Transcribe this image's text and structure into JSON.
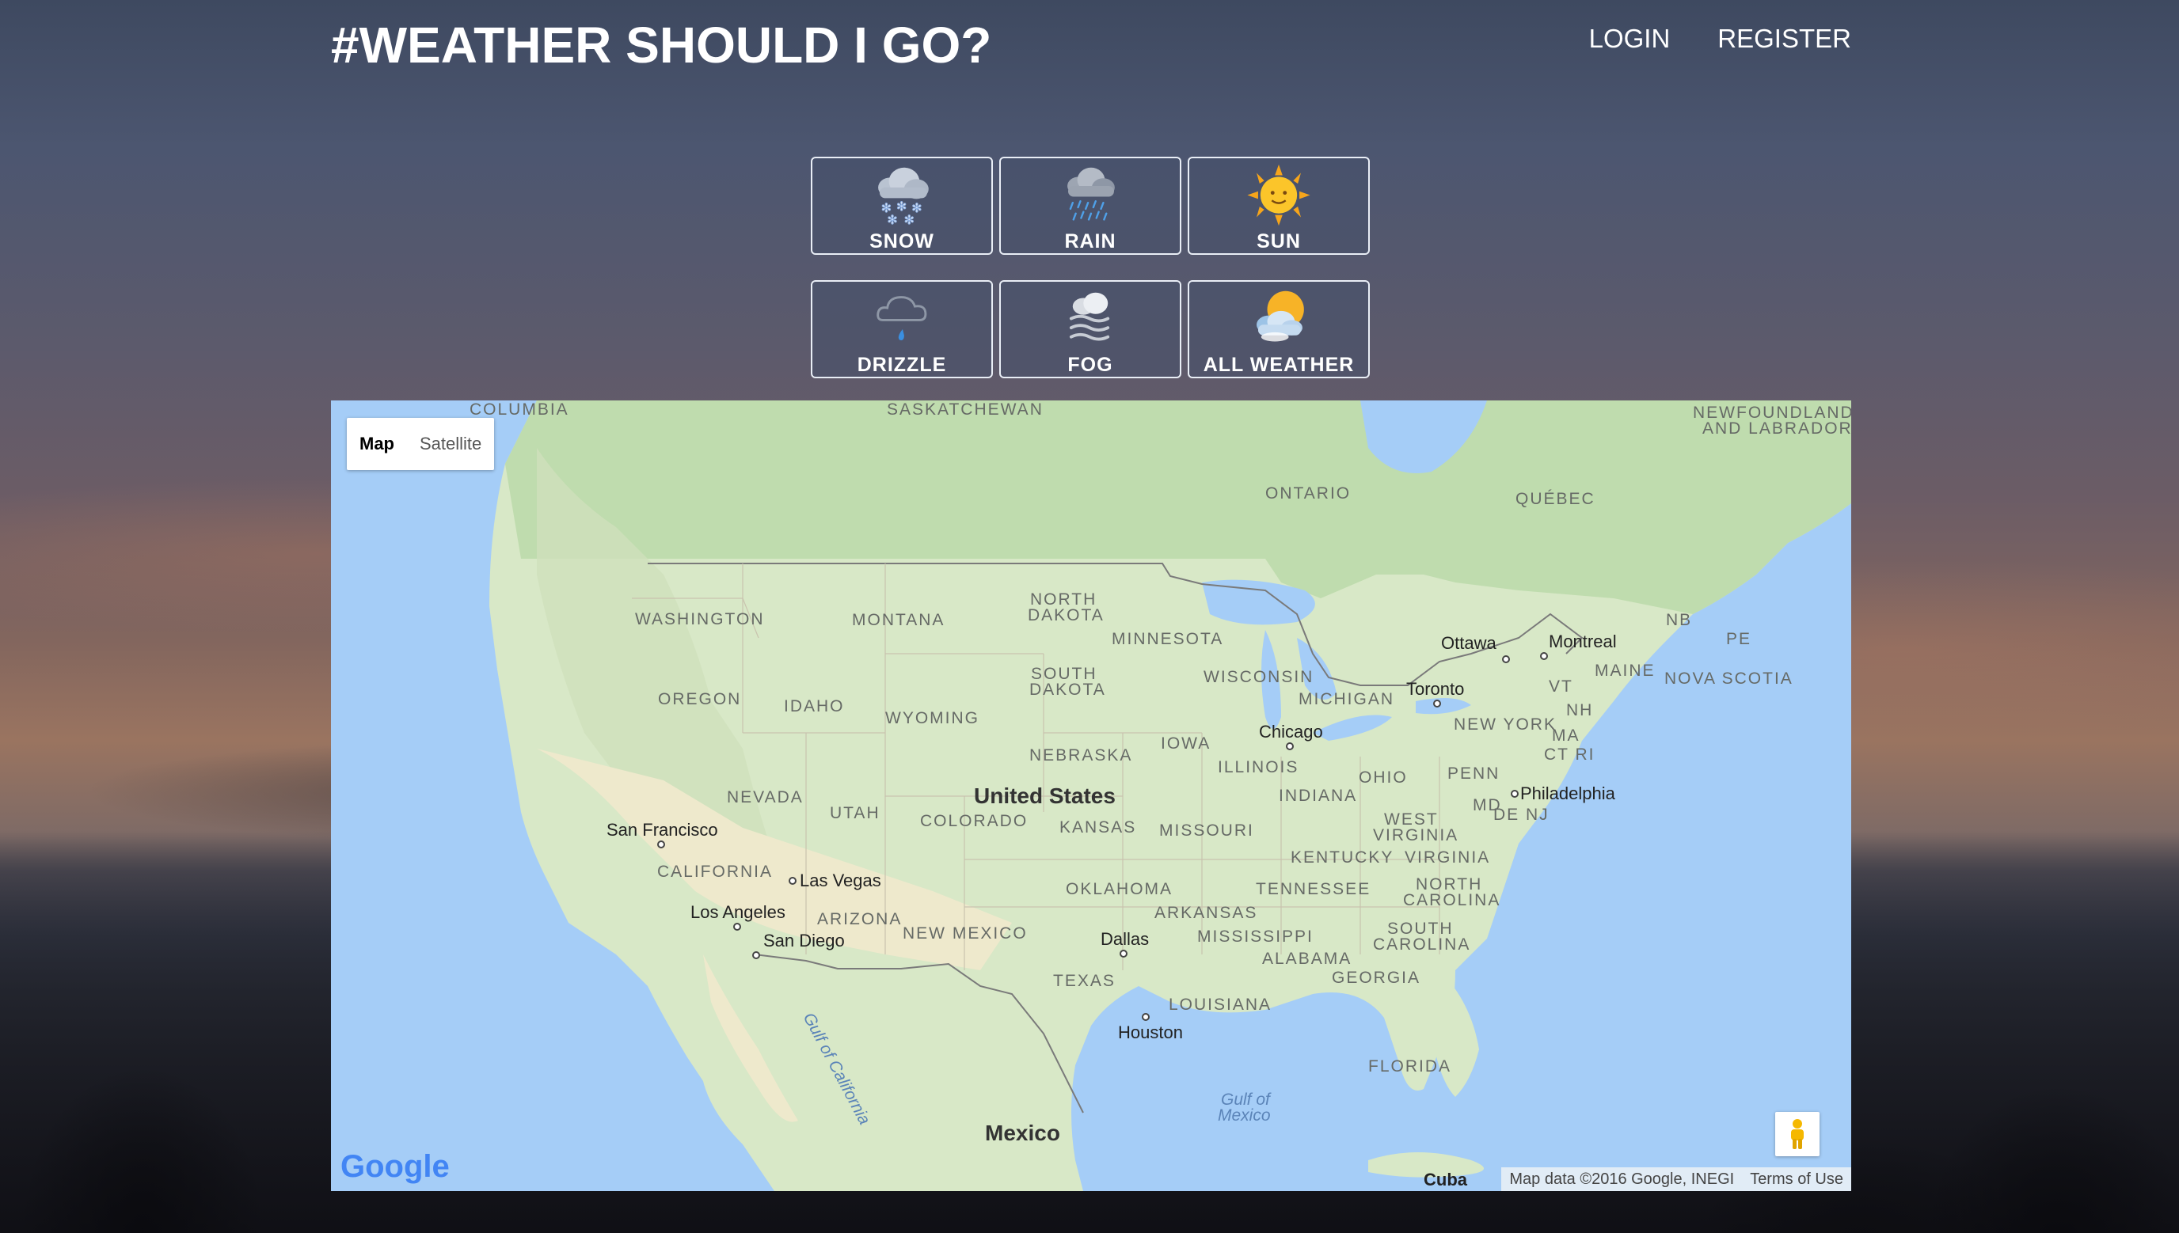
{
  "header": {
    "title": "#WEATHER SHOULD I GO?",
    "nav": {
      "login": "LOGIN",
      "register": "REGISTER"
    }
  },
  "weather_buttons": [
    {
      "label": "SNOW",
      "icon": "snow-cloud-icon"
    },
    {
      "label": "RAIN",
      "icon": "rain-cloud-icon"
    },
    {
      "label": "SUN",
      "icon": "sun-icon"
    },
    {
      "label": "DRIZZLE",
      "icon": "drizzle-cloud-icon"
    },
    {
      "label": "FOG",
      "icon": "fog-icon"
    },
    {
      "label": "ALL WEATHER",
      "icon": "sun-behind-cloud-icon"
    }
  ],
  "map": {
    "type_control": {
      "map": "Map",
      "satellite": "Satellite",
      "active": "Map"
    },
    "regions": {
      "columbia": "COLUMBIA",
      "saskatchewan": "SASKATCHEWAN",
      "newfoundland1": "NEWFOUNDLAND",
      "newfoundland2": "AND LABRADOR",
      "ontario": "ONTARIO",
      "quebec": "QUÉBEC",
      "washington": "WASHINGTON",
      "montana": "MONTANA",
      "north_dakota1": "NORTH",
      "north_dakota2": "DAKOTA",
      "minnesota": "MINNESOTA",
      "oregon": "OREGON",
      "idaho": "IDAHO",
      "south_dakota1": "SOUTH",
      "south_dakota2": "DAKOTA",
      "wyoming": "WYOMING",
      "wisconsin": "WISCONSIN",
      "michigan": "MICHIGAN",
      "nebraska": "NEBRASKA",
      "iowa": "IOWA",
      "illinois": "ILLINOIS",
      "ohio": "OHIO",
      "nevada": "NEVADA",
      "utah": "UTAH",
      "colorado": "COLORADO",
      "kansas": "KANSAS",
      "missouri": "MISSOURI",
      "indiana": "INDIANA",
      "california": "CALIFORNIA",
      "oklahoma": "OKLAHOMA",
      "arizona": "ARIZONA",
      "new_mexico": "NEW MEXICO",
      "arkansas": "ARKANSAS",
      "tennessee": "TENNESSEE",
      "kentucky": "KENTUCKY",
      "west_virginia1": "WEST",
      "west_virginia2": "VIRGINIA",
      "virginia": "VIRGINIA",
      "north_carolina1": "NORTH",
      "north_carolina2": "CAROLINA",
      "south_carolina1": "SOUTH",
      "south_carolina2": "CAROLINA",
      "mississippi": "MISSISSIPPI",
      "alabama": "ALABAMA",
      "georgia": "GEORGIA",
      "texas": "TEXAS",
      "louisiana": "LOUISIANA",
      "florida": "FLORIDA",
      "penn": "PENN",
      "new_york": "NEW YORK",
      "nb": "NB",
      "pe": "PE",
      "maine": "MAINE",
      "nova_scotia": "NOVA SCOTIA",
      "vt": "VT",
      "nh": "NH",
      "ma": "MA",
      "ct_ri": "CT RI",
      "md": "MD",
      "de_nj": "DE NJ"
    },
    "cities": {
      "ottawa": "Ottawa",
      "montreal": "Montreal",
      "toronto": "Toronto",
      "chicago": "Chicago",
      "philadelphia": "Philadelphia",
      "san_francisco": "San Francisco",
      "las_vegas": "Las Vegas",
      "los_angeles": "Los Angeles",
      "san_diego": "San Diego",
      "dallas": "Dallas",
      "houston": "Houston",
      "cuba": "Cuba"
    },
    "countries": {
      "us": "United States",
      "mexico": "Mexico"
    },
    "water": {
      "gulf_california": "Gulf of California",
      "gulf_mexico1": "Gulf of",
      "gulf_mexico2": "Mexico"
    },
    "google_logo": "Google",
    "attribution": {
      "data": "Map data ©2016 Google, INEGI",
      "terms": "Terms of Use"
    }
  }
}
